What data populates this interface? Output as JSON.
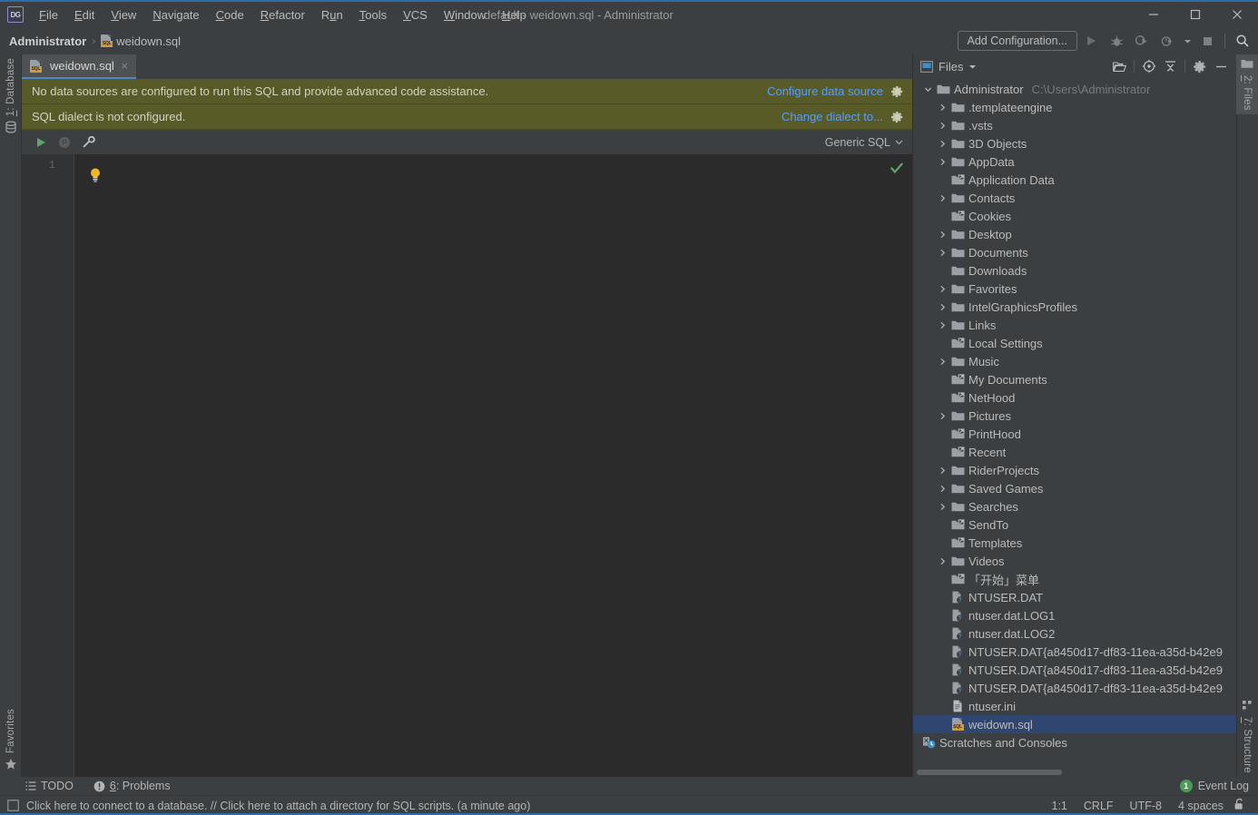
{
  "window": {
    "title": "default - weidown.sql - Administrator",
    "logo_text": "DG",
    "minimize_label": "Minimize",
    "maximize_label": "Maximize",
    "close_label": "Close"
  },
  "menubar": {
    "items": [
      {
        "label": "File",
        "mnemonic": "F"
      },
      {
        "label": "Edit",
        "mnemonic": "E"
      },
      {
        "label": "View",
        "mnemonic": "V"
      },
      {
        "label": "Navigate",
        "mnemonic": "N"
      },
      {
        "label": "Code",
        "mnemonic": "C"
      },
      {
        "label": "Refactor",
        "mnemonic": "R"
      },
      {
        "label": "Run",
        "mnemonic": "u"
      },
      {
        "label": "Tools",
        "mnemonic": "T"
      },
      {
        "label": "VCS",
        "mnemonic": "V"
      },
      {
        "label": "Window",
        "mnemonic": "W"
      },
      {
        "label": "Help",
        "mnemonic": "H"
      }
    ]
  },
  "navbar": {
    "breadcrumb_root": "Administrator",
    "breadcrumb_separator": "›",
    "breadcrumb_file": "weidown.sql",
    "add_configuration_label": "Add Configuration...",
    "buttons": [
      "run-icon",
      "debug-icon",
      "run-with-coverage-icon",
      "profile-icon",
      "profile-dropdown-icon",
      "stop-icon",
      "search-everywhere-icon"
    ]
  },
  "left_tool_strip": {
    "database_tab": "1: Database",
    "database_mnemonic": "1",
    "favorites_tab": "Favorites"
  },
  "right_tool_strip": {
    "files_tab": "2: Files",
    "files_mnemonic": "2",
    "structure_tab": "7: Structure",
    "structure_mnemonic": "7"
  },
  "editor": {
    "tab_name": "weidown.sql",
    "tab_close": "×",
    "notifications": [
      {
        "text": "No data sources are configured to run this SQL and provide advanced code assistance.",
        "link": "Configure data source",
        "gear": "gear-icon"
      },
      {
        "text": "SQL dialect is not configured.",
        "link": "Change dialect to...",
        "gear": "gear-icon"
      }
    ],
    "toolbar_buttons": [
      "execute-icon",
      "stop-disabled-icon",
      "settings-wrench-icon"
    ],
    "dialect_label": "Generic SQL",
    "dialect_chevron": "∨",
    "line_numbers": [
      "1"
    ],
    "content": "",
    "inspection_status": "ok-check-icon",
    "intention_bulb": "lightbulb-icon"
  },
  "files_panel": {
    "title": "Files",
    "title_chevron": "▼",
    "header_buttons": [
      "open-folder-icon",
      "scroll-from-source-icon",
      "collapse-all-icon",
      "settings-gear-icon",
      "hide-panel-icon"
    ],
    "root": {
      "label": "Administrator",
      "path": "C:\\Users\\Administrator",
      "expanded": true
    },
    "items": [
      {
        "label": ".templateengine",
        "icon": "folder-icon",
        "arrow": true
      },
      {
        "label": ".vsts",
        "icon": "folder-icon",
        "arrow": true
      },
      {
        "label": "3D Objects",
        "icon": "folder-icon",
        "arrow": true
      },
      {
        "label": "AppData",
        "icon": "folder-icon",
        "arrow": true
      },
      {
        "label": "Application Data",
        "icon": "folder-link-icon",
        "arrow": false
      },
      {
        "label": "Contacts",
        "icon": "folder-icon",
        "arrow": true
      },
      {
        "label": "Cookies",
        "icon": "folder-link-icon",
        "arrow": false
      },
      {
        "label": "Desktop",
        "icon": "folder-icon",
        "arrow": true
      },
      {
        "label": "Documents",
        "icon": "folder-icon",
        "arrow": true
      },
      {
        "label": "Downloads",
        "icon": "folder-icon",
        "arrow": false
      },
      {
        "label": "Favorites",
        "icon": "folder-icon",
        "arrow": true
      },
      {
        "label": "IntelGraphicsProfiles",
        "icon": "folder-icon",
        "arrow": true
      },
      {
        "label": "Links",
        "icon": "folder-icon",
        "arrow": true
      },
      {
        "label": "Local Settings",
        "icon": "folder-link-icon",
        "arrow": false
      },
      {
        "label": "Music",
        "icon": "folder-icon",
        "arrow": true
      },
      {
        "label": "My Documents",
        "icon": "folder-link-icon",
        "arrow": false
      },
      {
        "label": "NetHood",
        "icon": "folder-link-icon",
        "arrow": false
      },
      {
        "label": "Pictures",
        "icon": "folder-icon",
        "arrow": true
      },
      {
        "label": "PrintHood",
        "icon": "folder-link-icon",
        "arrow": false
      },
      {
        "label": "Recent",
        "icon": "folder-link-icon",
        "arrow": false
      },
      {
        "label": "RiderProjects",
        "icon": "folder-icon",
        "arrow": true
      },
      {
        "label": "Saved Games",
        "icon": "folder-icon",
        "arrow": true
      },
      {
        "label": "Searches",
        "icon": "folder-icon",
        "arrow": true
      },
      {
        "label": "SendTo",
        "icon": "folder-link-icon",
        "arrow": false
      },
      {
        "label": "Templates",
        "icon": "folder-link-icon",
        "arrow": false
      },
      {
        "label": "Videos",
        "icon": "folder-icon",
        "arrow": true
      },
      {
        "label": "「开始」菜单",
        "icon": "folder-link-icon",
        "arrow": false
      },
      {
        "label": "NTUSER.DAT",
        "icon": "unknown-file-icon",
        "arrow": false
      },
      {
        "label": "ntuser.dat.LOG1",
        "icon": "unknown-file-icon",
        "arrow": false
      },
      {
        "label": "ntuser.dat.LOG2",
        "icon": "unknown-file-icon",
        "arrow": false
      },
      {
        "label": "NTUSER.DAT{a8450d17-df83-11ea-a35d-b42e9",
        "icon": "unknown-file-icon",
        "arrow": false
      },
      {
        "label": "NTUSER.DAT{a8450d17-df83-11ea-a35d-b42e9",
        "icon": "unknown-file-icon",
        "arrow": false
      },
      {
        "label": "NTUSER.DAT{a8450d17-df83-11ea-a35d-b42e9",
        "icon": "unknown-file-icon",
        "arrow": false
      },
      {
        "label": "ntuser.ini",
        "icon": "text-file-icon",
        "arrow": false
      },
      {
        "label": "weidown.sql",
        "icon": "sql-file-icon",
        "arrow": false,
        "selected": true
      },
      {
        "label": "Scratches and Consoles",
        "icon": "scratches-icon",
        "arrow": false,
        "root_level": true
      }
    ]
  },
  "bottom_bar": {
    "todo_label": "TODO",
    "problems_label": "Problems",
    "problems_mnemonic": "6",
    "problems_prefix": "6: ",
    "event_log_label": "Event Log",
    "event_log_count": "1"
  },
  "status_bar": {
    "message": "Click here to connect to a database. // Click here to attach a directory for SQL scripts. (a minute ago)",
    "caret_position": "1:1",
    "line_separator": "CRLF",
    "encoding": "UTF-8",
    "indent": "4 spaces",
    "lock_state": "unlocked-icon"
  },
  "colors": {
    "accent_blue": "#2d6ca8",
    "panel_bg": "#3c3f41",
    "editor_bg": "#2b2b2b",
    "notification_bg": "#585b28",
    "link_blue": "#589df6",
    "selection_blue": "#2f4770",
    "green": "#499c54",
    "sql_label_orange": "#cc9b44"
  }
}
